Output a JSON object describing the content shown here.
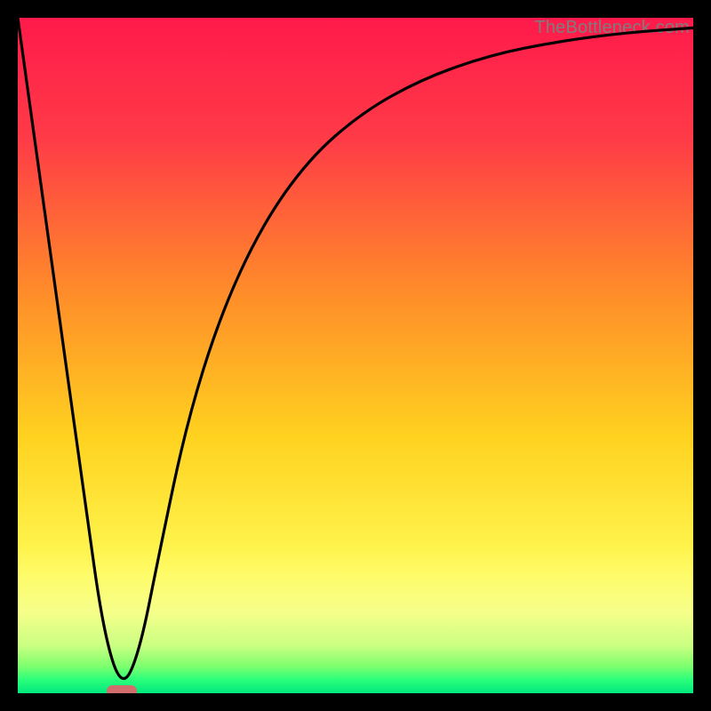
{
  "watermark": "TheBottleneck.com",
  "colors": {
    "frame": "#000000",
    "watermark": "#7d7d7d",
    "curve": "#000000",
    "marker": "#d16d6d",
    "gradient_stops": [
      {
        "pct": 0,
        "color": "#ff1a4b"
      },
      {
        "pct": 18,
        "color": "#ff3b47"
      },
      {
        "pct": 40,
        "color": "#ff8a2a"
      },
      {
        "pct": 62,
        "color": "#ffd21f"
      },
      {
        "pct": 78,
        "color": "#fff24a"
      },
      {
        "pct": 82,
        "color": "#fffb66"
      },
      {
        "pct": 88,
        "color": "#f6ff8a"
      },
      {
        "pct": 93,
        "color": "#c9ff82"
      },
      {
        "pct": 96,
        "color": "#7dff6e"
      },
      {
        "pct": 98,
        "color": "#2bff7a"
      },
      {
        "pct": 100,
        "color": "#00e87e"
      }
    ]
  },
  "chart_data": {
    "type": "line",
    "title": "",
    "xlabel": "",
    "ylabel": "",
    "xlim": [
      0,
      1
    ],
    "ylim": [
      0,
      1
    ],
    "series": [
      {
        "name": "bottleneck-curve",
        "x": [
          0.0,
          0.05,
          0.1,
          0.127,
          0.154,
          0.18,
          0.21,
          0.25,
          0.3,
          0.36,
          0.43,
          0.51,
          0.6,
          0.7,
          0.8,
          0.9,
          1.0
        ],
        "y": [
          1.0,
          0.64,
          0.28,
          0.09,
          0.005,
          0.06,
          0.21,
          0.4,
          0.56,
          0.69,
          0.79,
          0.86,
          0.91,
          0.945,
          0.965,
          0.978,
          0.985
        ]
      }
    ],
    "markers": [
      {
        "name": "min-point",
        "x": 0.154,
        "y": 0.0,
        "shape": "pill"
      }
    ],
    "grid": false,
    "legend": false
  }
}
